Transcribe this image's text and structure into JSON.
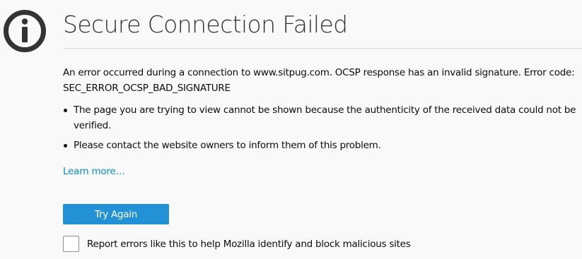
{
  "page": {
    "title": "Secure Connection Failed",
    "short_description": "An error occurred during a connection to www.sitpug.com. OCSP response has an invalid signature. Error code: SEC_ERROR_OCSP_BAD_SIGNATURE",
    "bullets": [
      "The page you are trying to view cannot be shown because the authenticity of the received data could not be verified.",
      "Please contact the website owners to inform them of this problem."
    ],
    "learn_more": "Learn more…",
    "try_again_label": "Try Again",
    "report_label": "Report errors like this to help Mozilla identify and block malicious sites",
    "report_checked": false
  },
  "icons": {
    "error": "info-circle-icon"
  },
  "colors": {
    "background": "#f9f9fa",
    "icon": "#333333",
    "title": "#333333",
    "link": "#0a8dc8",
    "button": "#2291d6",
    "button_text": "#ffffff",
    "rule": "#d7d7db"
  }
}
